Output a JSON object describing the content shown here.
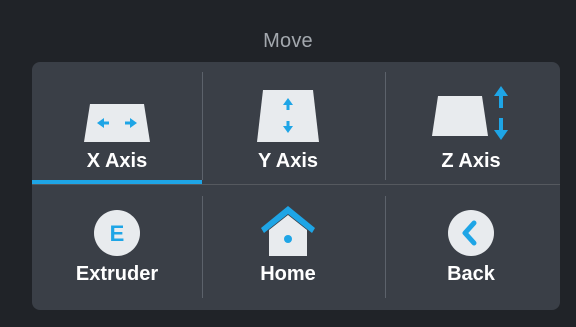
{
  "header": {
    "title": "Move"
  },
  "buttons": {
    "x_axis": {
      "label": "X Axis",
      "icon": "x-axis-move-icon",
      "active": true
    },
    "y_axis": {
      "label": "Y Axis",
      "icon": "y-axis-move-icon"
    },
    "z_axis": {
      "label": "Z Axis",
      "icon": "z-axis-move-icon"
    },
    "extruder": {
      "label": "Extruder",
      "icon": "extruder-icon",
      "glyph": "E"
    },
    "home": {
      "label": "Home",
      "icon": "home-icon"
    },
    "back": {
      "label": "Back",
      "icon": "back-chevron-icon"
    }
  },
  "colors": {
    "accent": "#1ea5e6",
    "panel": "#3a3f47",
    "background": "#202328",
    "icon_fill": "#e8ebee",
    "title_text": "#a3a8ae",
    "label_text": "#ffffff"
  }
}
